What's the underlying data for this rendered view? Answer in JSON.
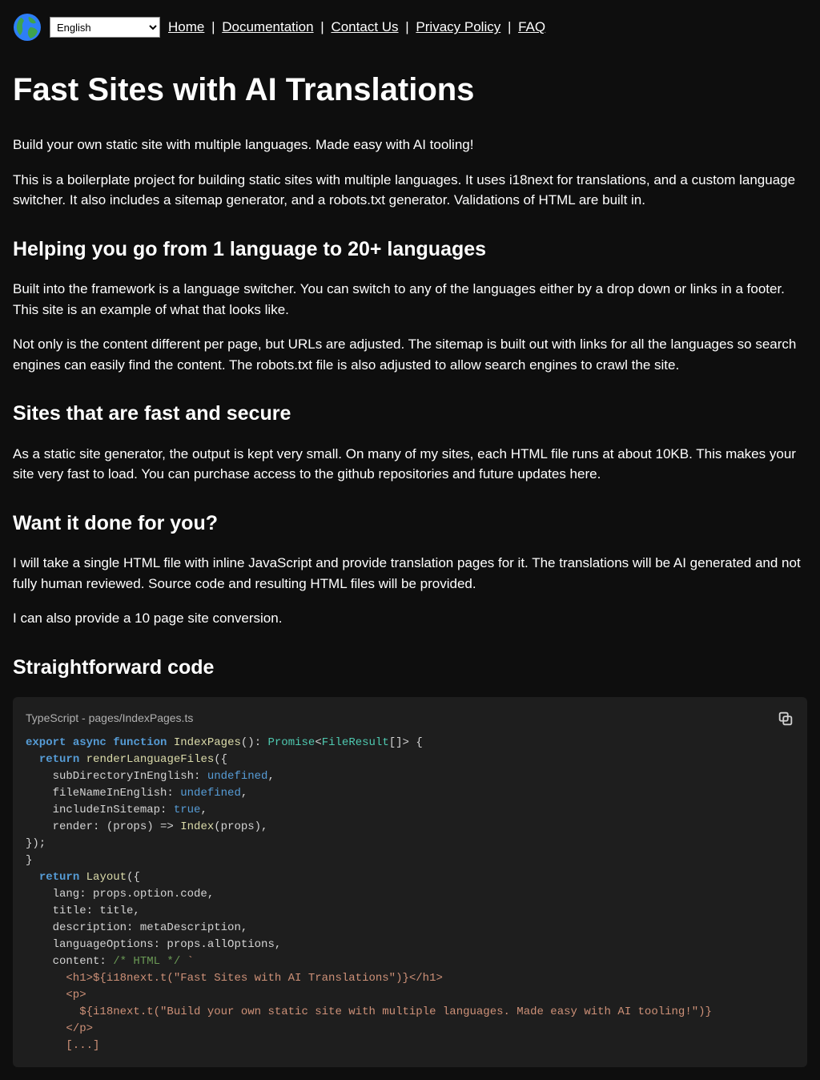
{
  "header": {
    "language_select_value": "English",
    "nav": {
      "home": "Home",
      "documentation": "Documentation",
      "contact": "Contact Us",
      "privacy": "Privacy Policy",
      "faq": "FAQ",
      "sep": " | "
    }
  },
  "main": {
    "h1": "Fast Sites with AI Translations",
    "p1": "Build your own static site with multiple languages. Made easy with AI tooling!",
    "p2": "This is a boilerplate project for building static sites with multiple languages. It uses i18next for translations, and a custom language switcher. It also includes a sitemap generator, and a robots.txt generator. Validations of HTML are built in.",
    "h2a": "Helping you go from 1 language to 20+ languages",
    "p3": "Built into the framework is a language switcher. You can switch to any of the languages either by a drop down or links in a footer. This site is an example of what that looks like.",
    "p4": "Not only is the content different per page, but URLs are adjusted. The sitemap is built out with links for all the languages so search engines can easily find the content. The robots.txt file is also adjusted to allow search engines to crawl the site.",
    "h2b": "Sites that are fast and secure",
    "p5": "As a static site generator, the output is kept very small. On many of my sites, each HTML file runs at about 10KB. This makes your site very fast to load. You can purchase access to the github repositories and future updates here.",
    "h2c": "Want it done for you?",
    "p6": "I will take a single HTML file with inline JavaScript and provide translation pages for it. The translations will be AI generated and not fully human reviewed. Source code and resulting HTML files will be provided.",
    "p7": "I can also provide a 10 page site conversion.",
    "h2d": "Straightforward code"
  },
  "code": {
    "label": "TypeScript - pages/IndexPages.ts",
    "l1_export": "export",
    "l1_async": "async",
    "l1_function": "function",
    "l1_name": "IndexPages",
    "l1_rest1": "(): ",
    "l1_promise": "Promise",
    "l1_lt": "<",
    "l1_fr": "FileResult",
    "l1_rest2": "[]> {",
    "l2_return": "return",
    "l2_fn": "renderLanguageFiles",
    "l2_rest": "({",
    "l3a": "    subDirectoryInEnglish: ",
    "l3b": "undefined",
    "l3c": ",",
    "l4a": "    fileNameInEnglish: ",
    "l4b": "undefined",
    "l4c": ",",
    "l5a": "    includeInSitemap: ",
    "l5b": "true",
    "l5c": ",",
    "l6a": "    render: (props) => ",
    "l6b": "Index",
    "l6c": "(props),",
    "l7": "});",
    "l8": "}",
    "l9a": "return",
    "l9b": "Layout",
    "l9c": "({",
    "l10": "    lang: props.option.code,",
    "l11": "    title: title,",
    "l12": "    description: metaDescription,",
    "l13": "    languageOptions: props.allOptions,",
    "l14a": "    content: ",
    "l14b": "/* HTML */",
    "l14c": " `",
    "l15": "      <h1>${i18next.t(\"Fast Sites with AI Translations\")}</h1>",
    "l16": "      <p>",
    "l17": "        ${i18next.t(\"Build your own static site with multiple languages. Made easy with AI tooling!\")}",
    "l18": "      </p>",
    "l19": "      [...]"
  }
}
